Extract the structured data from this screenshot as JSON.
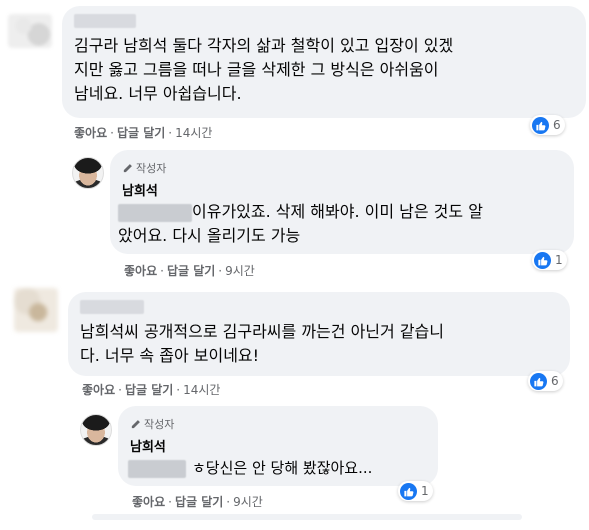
{
  "comments": [
    {
      "text_lines": [
        "김구라 남희석 둘다 각자의 삶과 철학이 있고 입장이 있겠",
        "지만 옳고 그름을 떠나 글을 삭제한 그 방식은 아쉬움이",
        "남네요. 너무 아쉽습니다."
      ],
      "actions": {
        "like": "좋아요",
        "reply": "답글 달기",
        "time": "14시간"
      },
      "reactions": "6"
    },
    {
      "badge": "작성자",
      "author": "남희석",
      "text_lines": [
        "이유가있죠. 삭제 해봐야. 이미 남은 것도 알",
        "았어요. 다시 올리기도 가능"
      ],
      "actions": {
        "like": "좋아요",
        "reply": "답글 달기",
        "time": "9시간"
      },
      "reactions": "1"
    },
    {
      "text_lines": [
        "남희석씨 공개적으로 김구라씨를 까는건 아닌거 같습니",
        "다. 너무 속 좁아 보이네요!"
      ],
      "actions": {
        "like": "좋아요",
        "reply": "답글 달기",
        "time": "14시간"
      },
      "reactions": "6"
    },
    {
      "badge": "작성자",
      "author": "남희석",
      "text_lines": [
        "ㅎ당신은 안 당해 봤잖아요..."
      ],
      "actions": {
        "like": "좋아요",
        "reply": "답글 달기",
        "time": "9시간"
      },
      "reactions": "1"
    }
  ],
  "colors": {
    "like_blue": "#1877f2",
    "bubble": "#f0f2f5",
    "meta_gray": "#65676b"
  },
  "icons": {
    "badge": "pencil-icon",
    "reaction": "thumbs-up-icon"
  }
}
